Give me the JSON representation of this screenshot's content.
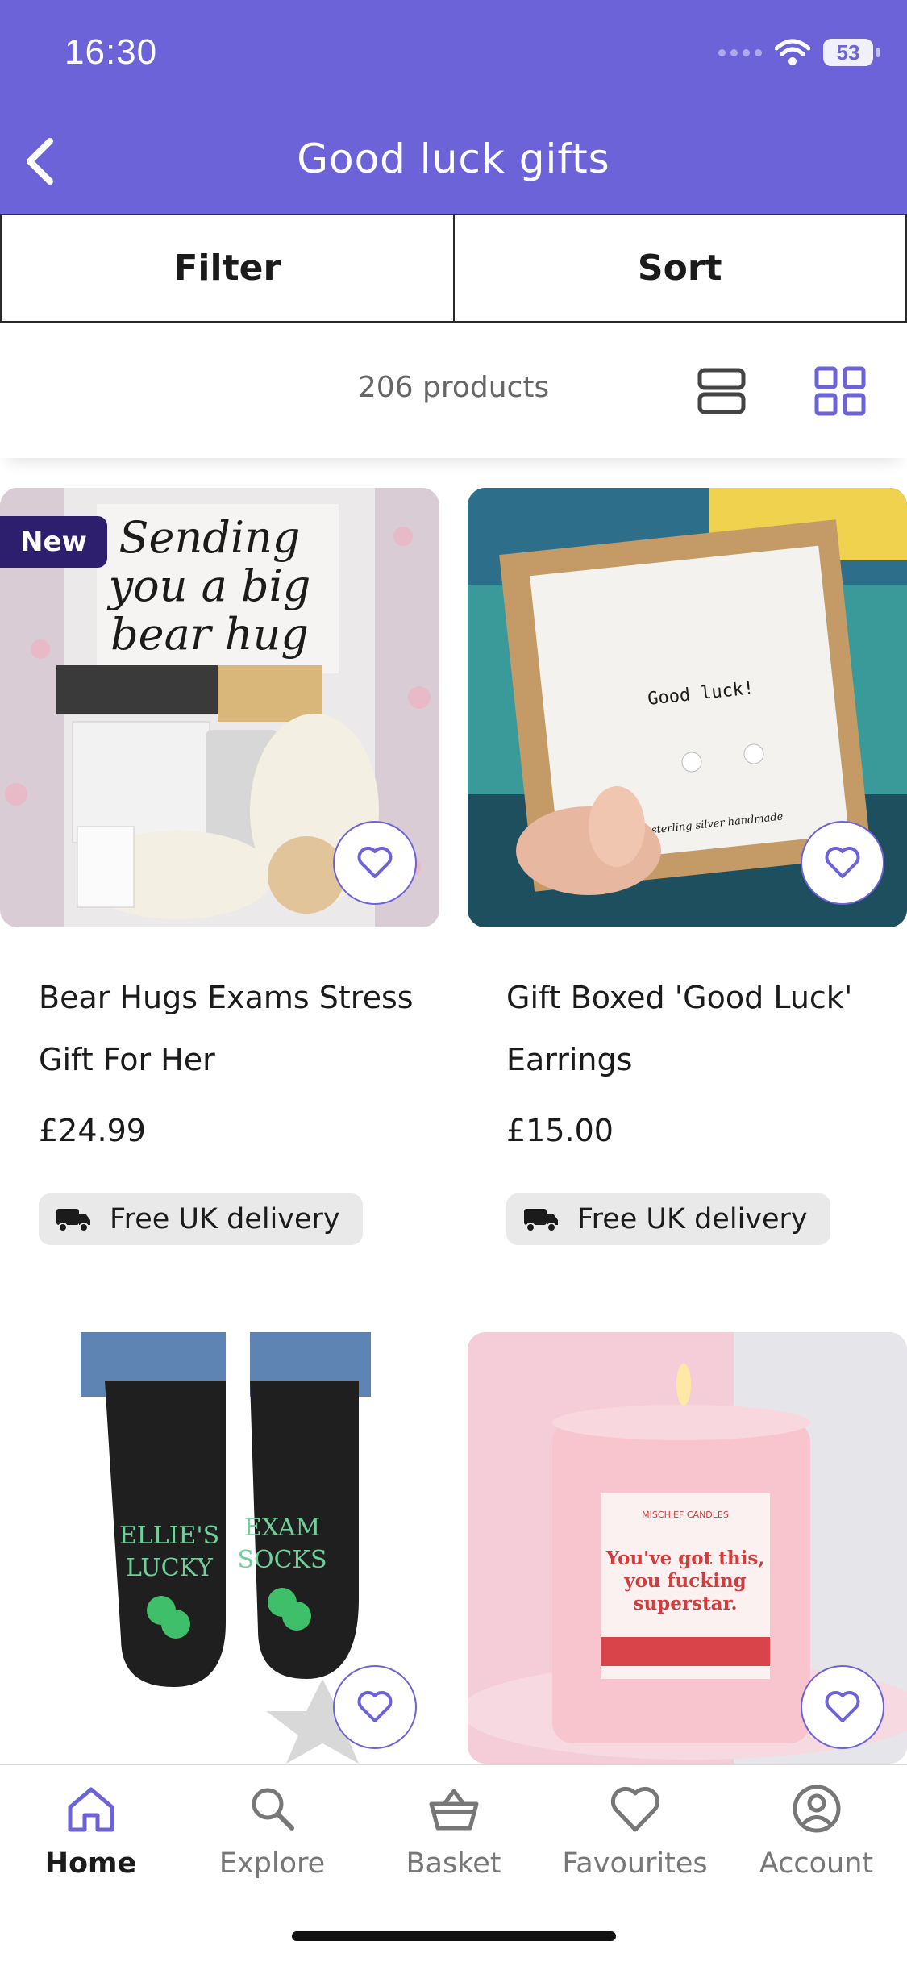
{
  "status_bar": {
    "time": "16:30",
    "battery": "53"
  },
  "header": {
    "title": "Good luck gifts"
  },
  "actions": {
    "filter_label": "Filter",
    "sort_label": "Sort"
  },
  "results": {
    "count_text": "206 products"
  },
  "products": [
    {
      "badge": "New",
      "name": "Bear Hugs Exams Stress Gift For Her",
      "price": "£24.99",
      "delivery": "Free UK delivery",
      "image_text": [
        "Sending",
        "you a big",
        "bear hug"
      ]
    },
    {
      "name": "Gift Boxed 'Good Luck' Earrings",
      "price": "£15.00",
      "delivery": "Free UK delivery",
      "image_text": [
        "Good luck!",
        "sterling silver handmade"
      ]
    },
    {
      "image_text": [
        "ELLIE'S",
        "LUCKY",
        "EXAM",
        "SOCKS"
      ]
    },
    {
      "image_text": [
        "MISCHIEF CANDLES",
        "You've got this,",
        "you fucking",
        "superstar."
      ]
    }
  ],
  "tabbar": {
    "items": [
      {
        "label": "Home",
        "icon": "home-icon"
      },
      {
        "label": "Explore",
        "icon": "search-icon"
      },
      {
        "label": "Basket",
        "icon": "basket-icon"
      },
      {
        "label": "Favourites",
        "icon": "heart-icon"
      },
      {
        "label": "Account",
        "icon": "account-icon"
      }
    ]
  },
  "colors": {
    "brand": "#6c63d8",
    "badge": "#2e1f6e",
    "delivery_bg": "#e9e9e9"
  }
}
